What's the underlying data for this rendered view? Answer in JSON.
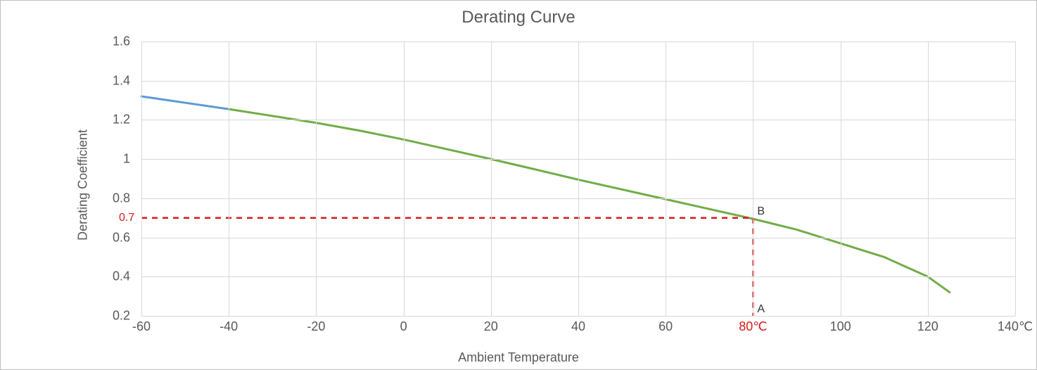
{
  "chart_data": {
    "type": "line",
    "title": "Derating Curve",
    "xlabel": "Ambient Temperature",
    "ylabel": "Derating Coefficient",
    "xlim": [
      -60,
      140
    ],
    "ylim": [
      0.2,
      1.6
    ],
    "xticks": [
      -60,
      -40,
      -20,
      0,
      20,
      40,
      60,
      80,
      100,
      120,
      140
    ],
    "yticks": [
      0.2,
      0.4,
      0.6,
      0.8,
      1,
      1.2,
      1.4,
      1.6
    ],
    "xtick_suffix_last": "℃",
    "series": [
      {
        "name": "extended-low-temp",
        "color": "#5b9bd5",
        "x": [
          -60,
          -40
        ],
        "y": [
          1.32,
          1.255
        ]
      },
      {
        "name": "derating-curve",
        "color": "#70ad47",
        "x": [
          -40,
          -30,
          -20,
          -10,
          0,
          10,
          20,
          30,
          40,
          50,
          60,
          70,
          80,
          90,
          100,
          110,
          120,
          125
        ],
        "y": [
          1.255,
          1.22,
          1.185,
          1.145,
          1.1,
          1.05,
          1.0,
          0.948,
          0.895,
          0.845,
          0.795,
          0.745,
          0.695,
          0.64,
          0.57,
          0.5,
          0.4,
          0.32
        ]
      }
    ],
    "annotations": {
      "marker_x": {
        "value": 80,
        "label": "80℃",
        "point_label": "A"
      },
      "marker_y": {
        "value": 0.7,
        "label": "0.7",
        "point_label": "B"
      }
    }
  }
}
